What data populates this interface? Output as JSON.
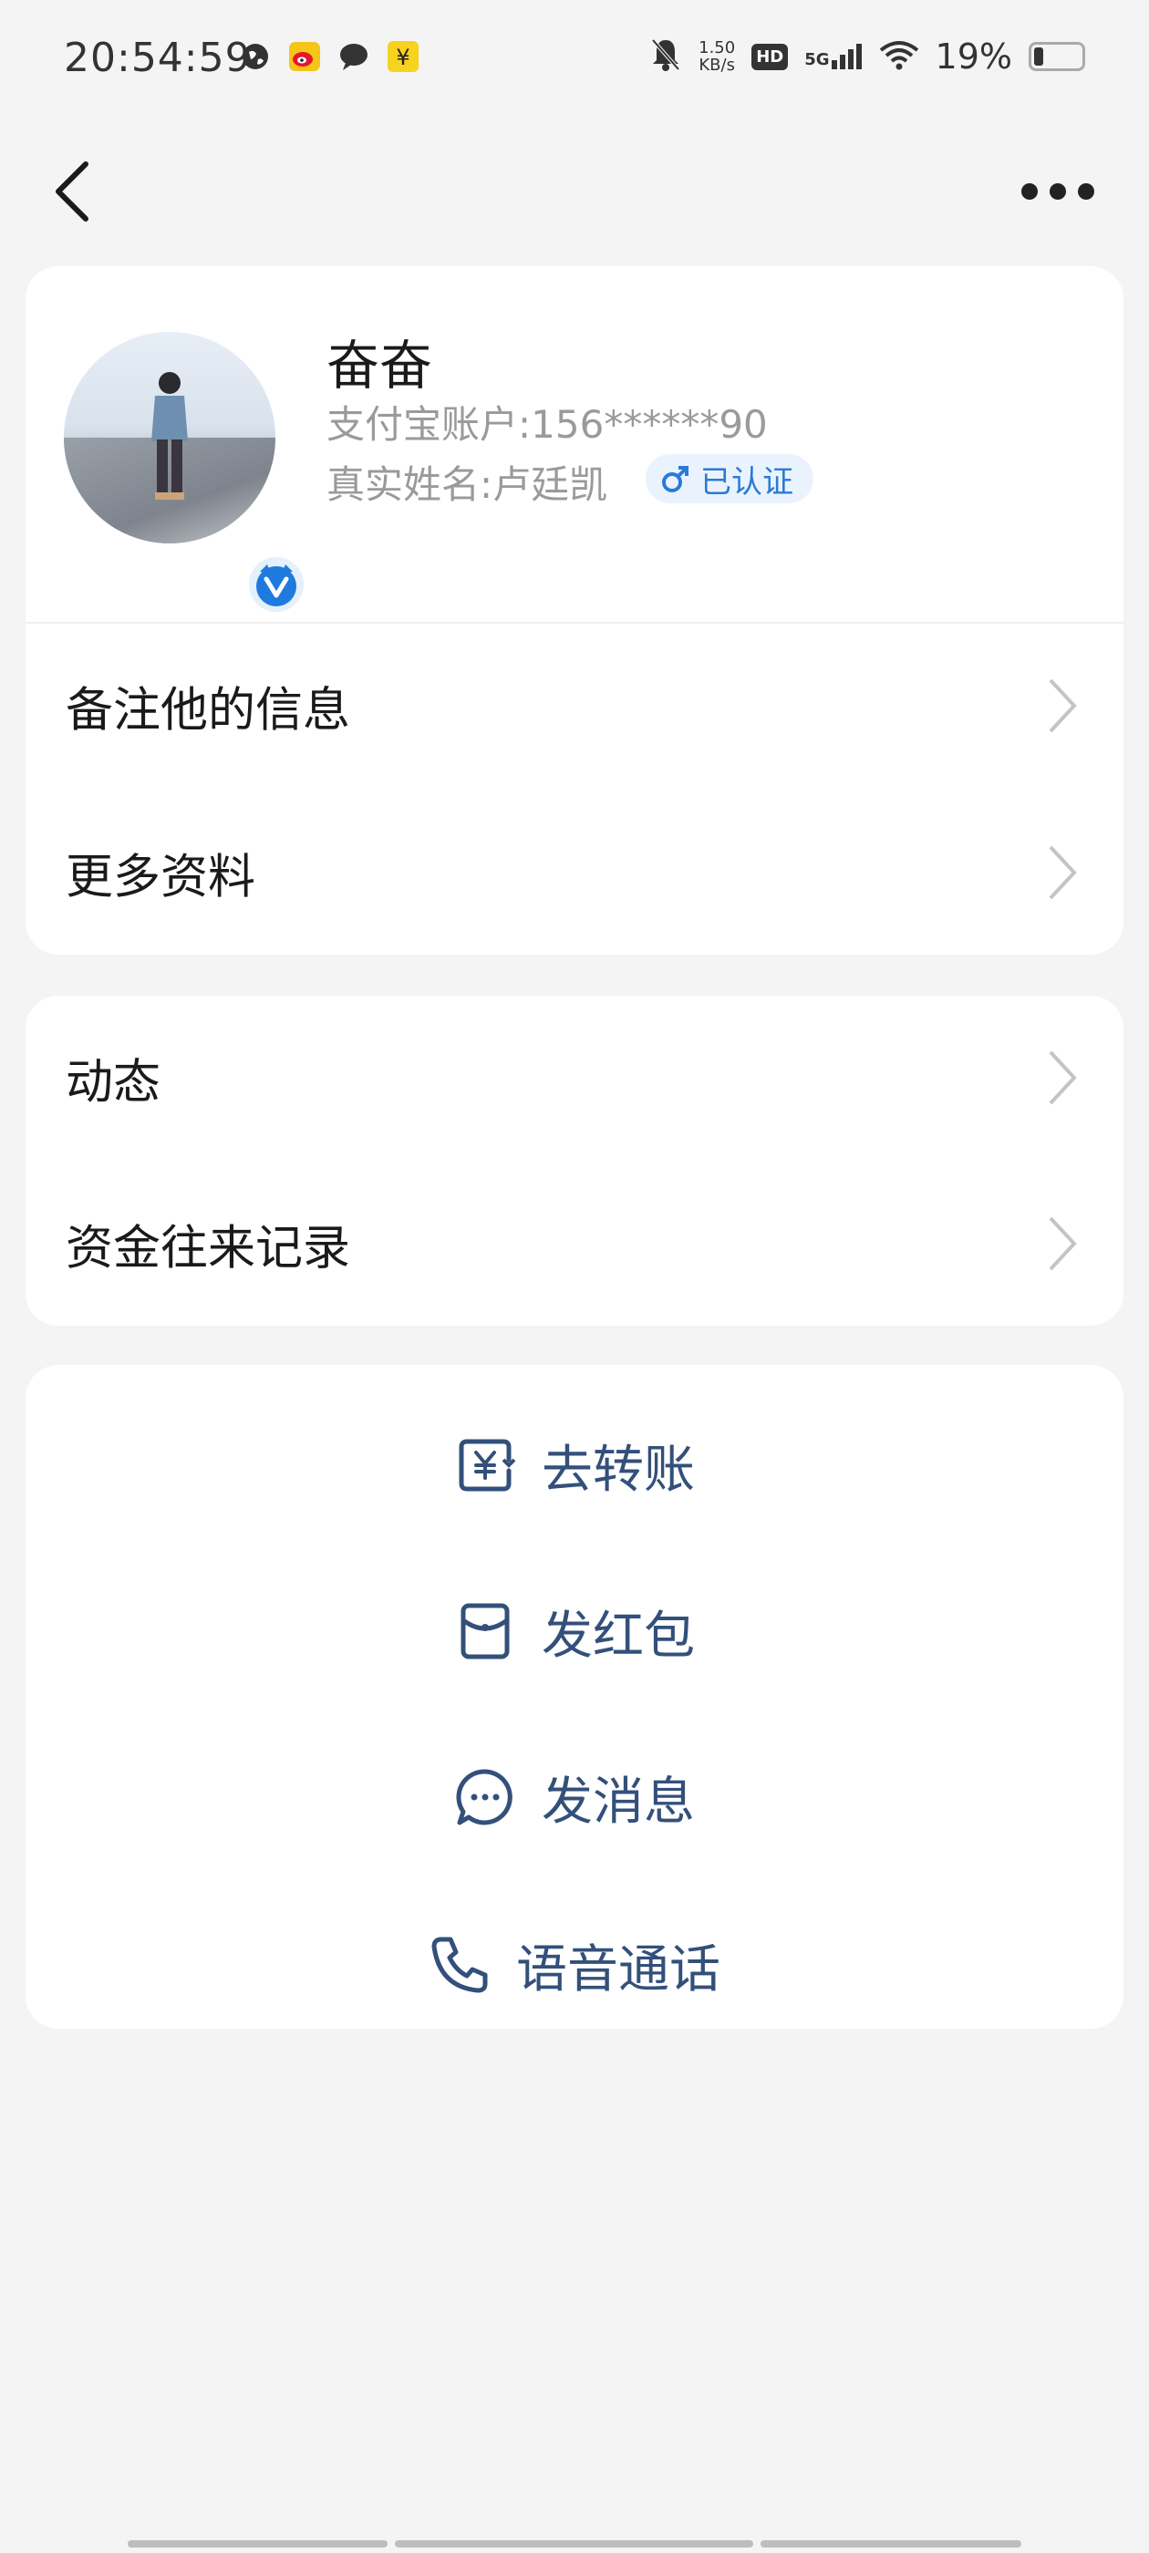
{
  "status_bar": {
    "time": "20:54:59",
    "net_speed_value": "1.50",
    "net_speed_unit": "KB/s",
    "hd": "HD",
    "network": "5G",
    "battery": "19%",
    "battery_level": 0.19,
    "notification_icons": [
      "globe-icon",
      "weibo-icon",
      "message-bubble-icon",
      "yuan-app-icon"
    ]
  },
  "header": {
    "back_icon": "chevron-left-icon",
    "more_icon": "more-horizontal-icon"
  },
  "profile": {
    "name": "奋奋",
    "account": "支付宝账户:156******90",
    "real_name": "真实姓名:卢廷凯",
    "gender_icon": "male-icon",
    "certified": "已认证",
    "badge_icon": "verified-v-icon"
  },
  "info_rows": [
    {
      "label": "备注他的信息"
    },
    {
      "label": "更多资料"
    }
  ],
  "activity_rows": [
    {
      "label": "动态"
    },
    {
      "label": "资金往来记录"
    }
  ],
  "actions": [
    {
      "label": "去转账",
      "icon": "transfer-yuan-icon"
    },
    {
      "label": "发红包",
      "icon": "red-envelope-icon"
    },
    {
      "label": "发消息",
      "icon": "chat-bubble-icon"
    },
    {
      "label": "语音通话",
      "icon": "phone-icon"
    }
  ],
  "colors": {
    "background": "#f4f4f4",
    "card": "#ffffff",
    "action_text": "#33507a",
    "certified_text": "#2a7ad8",
    "secondary_text": "#9a9a9a"
  }
}
